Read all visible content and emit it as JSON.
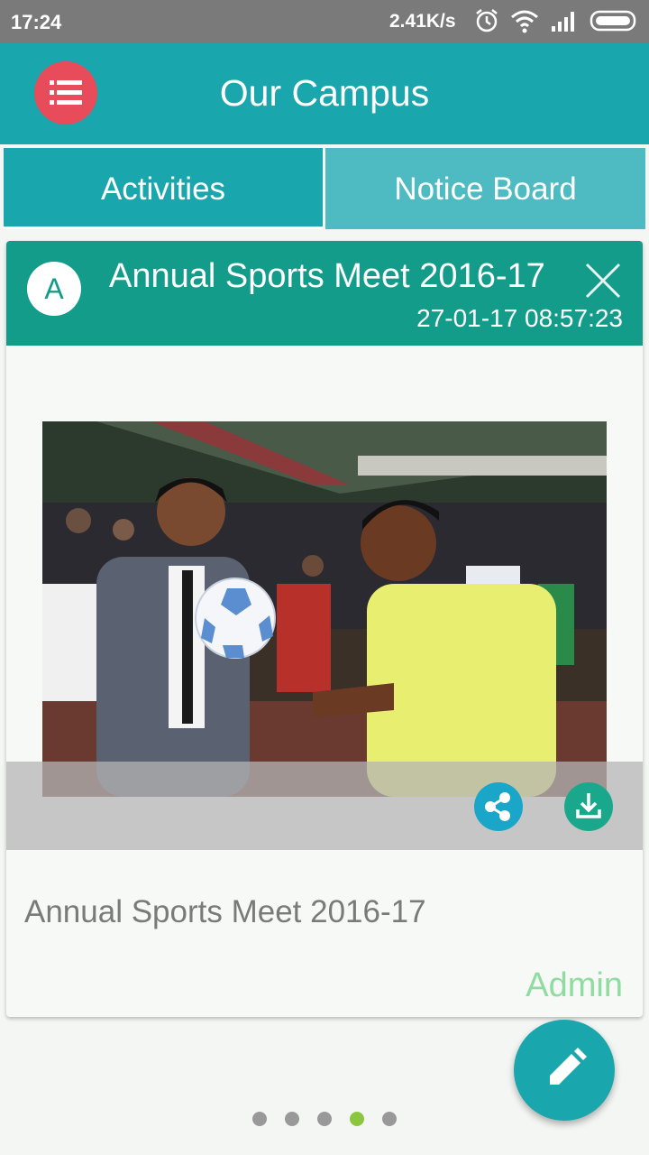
{
  "status_bar": {
    "time": "17:24",
    "network_speed": "2.41K/s",
    "icons": [
      "alarm-icon",
      "wifi-icon",
      "signal-icon",
      "battery-icon"
    ]
  },
  "app_bar": {
    "title": "Our Campus",
    "menu_icon": "list-icon",
    "menu_color": "#e84b5a",
    "bar_color": "#1aa6ad"
  },
  "tabs": [
    {
      "label": "Activities",
      "selected": true
    },
    {
      "label": "Notice Board",
      "selected": false
    }
  ],
  "post": {
    "avatar_letter": "A",
    "title": "Annual Sports Meet 2016-17",
    "timestamp": "27-01-17 08:57:23",
    "close_icon": "close-icon",
    "image_description_icon": "photo",
    "share_icon": "share-icon",
    "download_icon": "download-icon",
    "caption": "Annual Sports Meet 2016-17",
    "author": "Admin",
    "header_color": "#149c8a"
  },
  "fab": {
    "icon": "pencil-icon"
  },
  "pager": {
    "count": 5,
    "active_index": 3,
    "active_color": "#8cc63f"
  }
}
